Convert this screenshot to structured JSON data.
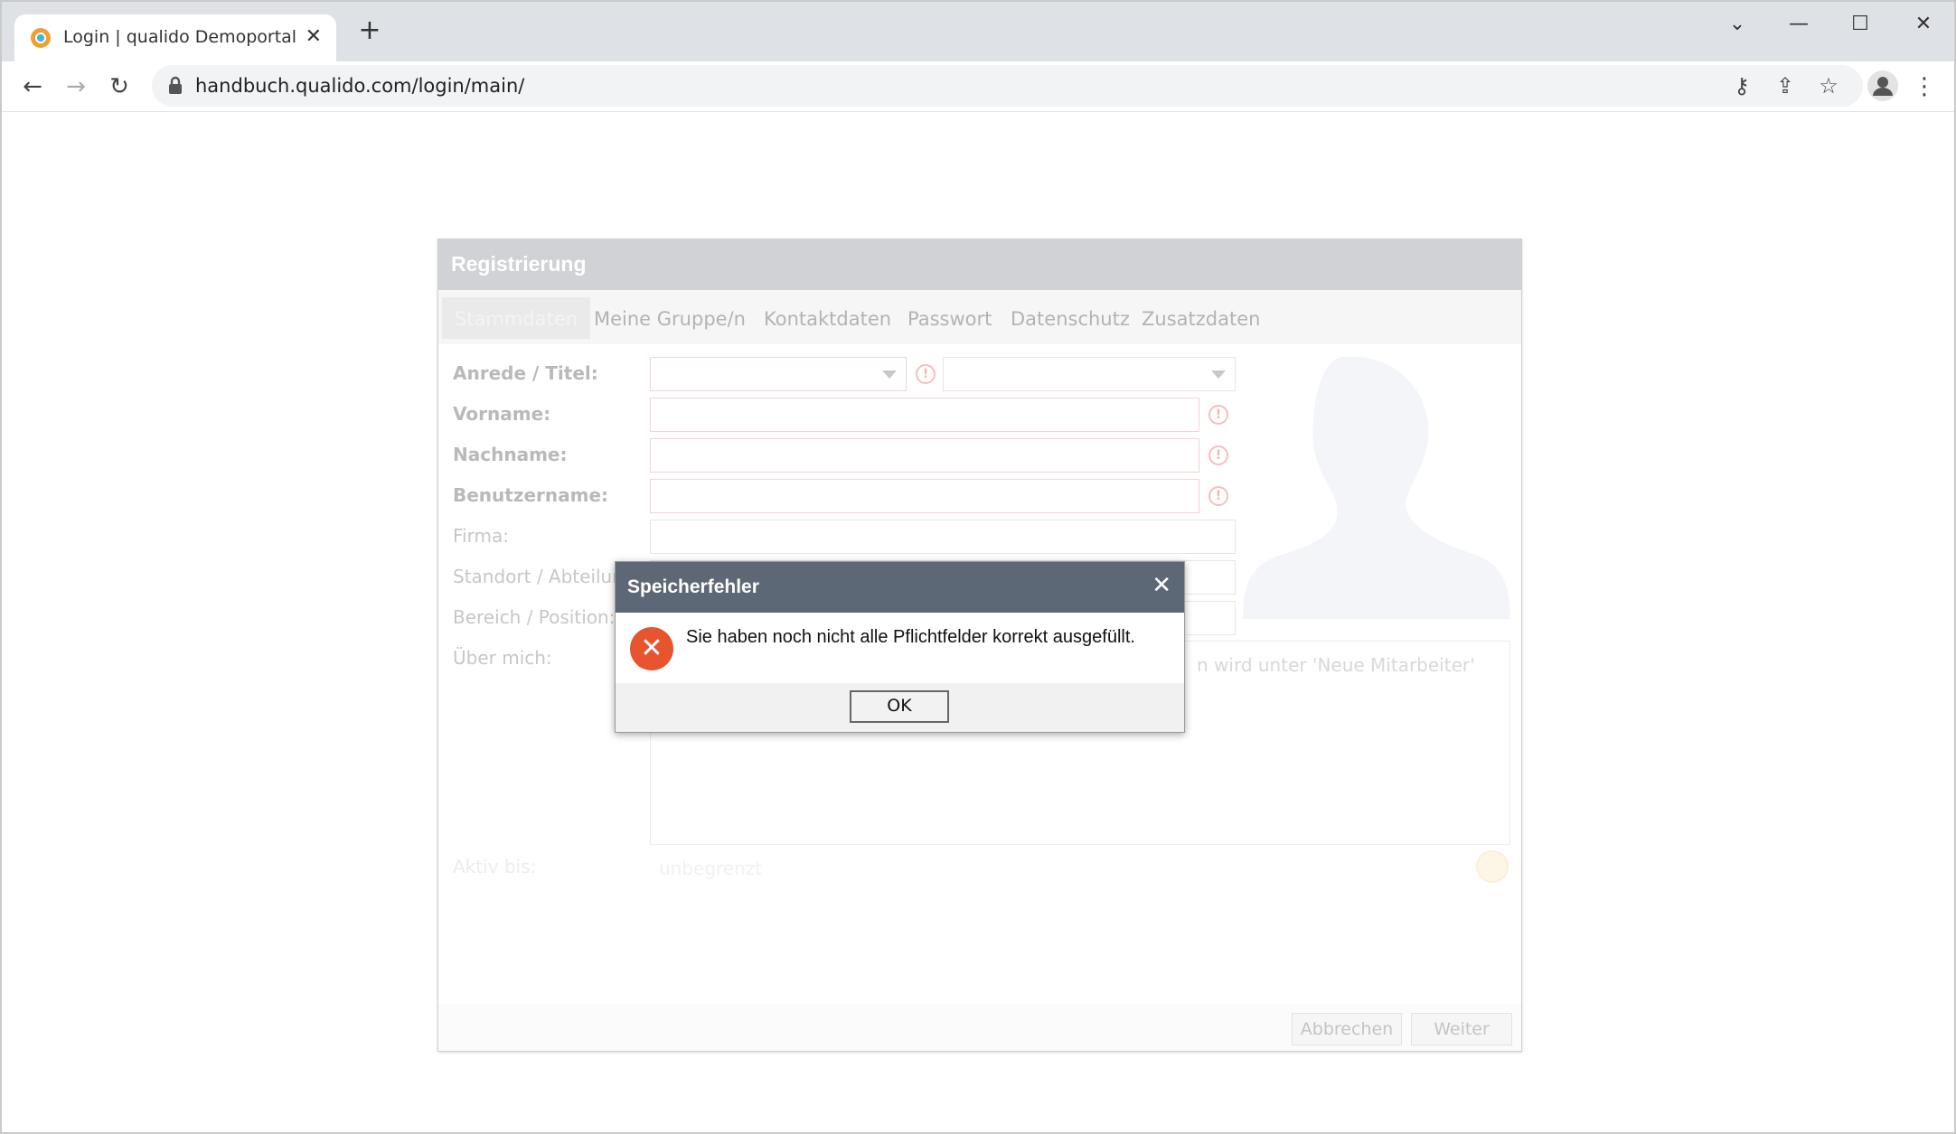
{
  "browser": {
    "tab_title": "Login | qualido Demoportal",
    "url": "handbuch.qualido.com/login/main/"
  },
  "registration": {
    "title": "Registrierung",
    "tabs": [
      "Stammdaten",
      "Meine Gruppe/n",
      "Kontaktdaten",
      "Passwort",
      "Datenschutz",
      "Zusatzdaten"
    ],
    "active_tab": "Stammdaten",
    "fields": {
      "anrede": "Anrede / Titel:",
      "vorname": "Vorname:",
      "nachname": "Nachname:",
      "benutzername": "Benutzername:",
      "firma": "Firma:",
      "standort": "Standort / Abteilun",
      "bereich": "Bereich / Position:",
      "ueber_mich": "Über mich:"
    },
    "about_placeholder": "n wird unter 'Neue Mitarbeiter'",
    "aktiv_label": "Aktiv bis:",
    "aktiv_value": "unbegrenzt",
    "cancel_label": "Abbrechen",
    "next_label": "Weiter"
  },
  "dialog": {
    "title": "Speicherfehler",
    "message": "Sie haben noch nicht alle Pflichtfelder korrekt ausgefüllt.",
    "ok_label": "OK",
    "icon": "error-icon",
    "error_color": "#e8542e",
    "header_color": "#5d6877"
  }
}
